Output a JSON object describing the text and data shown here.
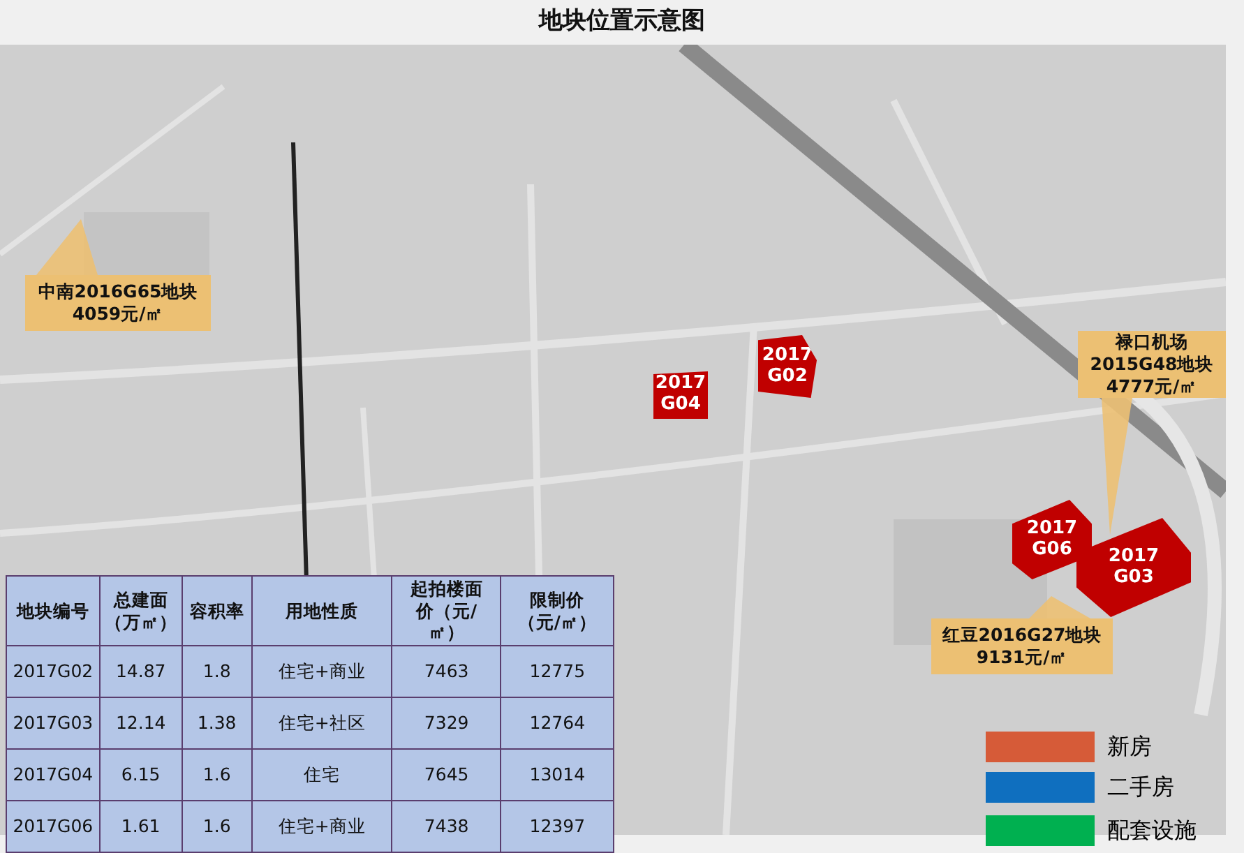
{
  "title": "地块位置示意图",
  "plots": [
    {
      "lines": [
        "2017",
        "G04"
      ]
    },
    {
      "lines": [
        "2017",
        "G02"
      ]
    },
    {
      "lines": [
        "2017",
        "G06"
      ]
    },
    {
      "lines": [
        "2017",
        "G03"
      ]
    }
  ],
  "callouts": [
    {
      "lines": [
        "中南2016G65地块",
        "4059元/㎡"
      ]
    },
    {
      "lines": [
        "禄口机场",
        "2015G48地块",
        "4777元/㎡"
      ]
    },
    {
      "lines": [
        "红豆2016G27地块",
        "9131元/㎡"
      ]
    }
  ],
  "table": {
    "columns": [
      "地块编号",
      "总建面（万㎡）",
      "容积率",
      "用地性质",
      "起拍楼面价（元/㎡）",
      "限制价（元/㎡）"
    ],
    "rows": [
      [
        "2017G02",
        "14.87",
        "1.8",
        "住宅+商业",
        "7463",
        "12775"
      ],
      [
        "2017G03",
        "12.14",
        "1.38",
        "住宅+社区",
        "7329",
        "12764"
      ],
      [
        "2017G04",
        "6.15",
        "1.6",
        "住宅",
        "7645",
        "13014"
      ],
      [
        "2017G06",
        "1.61",
        "1.6",
        "住宅+商业",
        "7438",
        "12397"
      ]
    ]
  },
  "legend": [
    {
      "label": "新房",
      "color": "#d65b38"
    },
    {
      "label": "二手房",
      "color": "#0f6fbf"
    },
    {
      "label": "配套设施",
      "color": "#00b050"
    }
  ]
}
